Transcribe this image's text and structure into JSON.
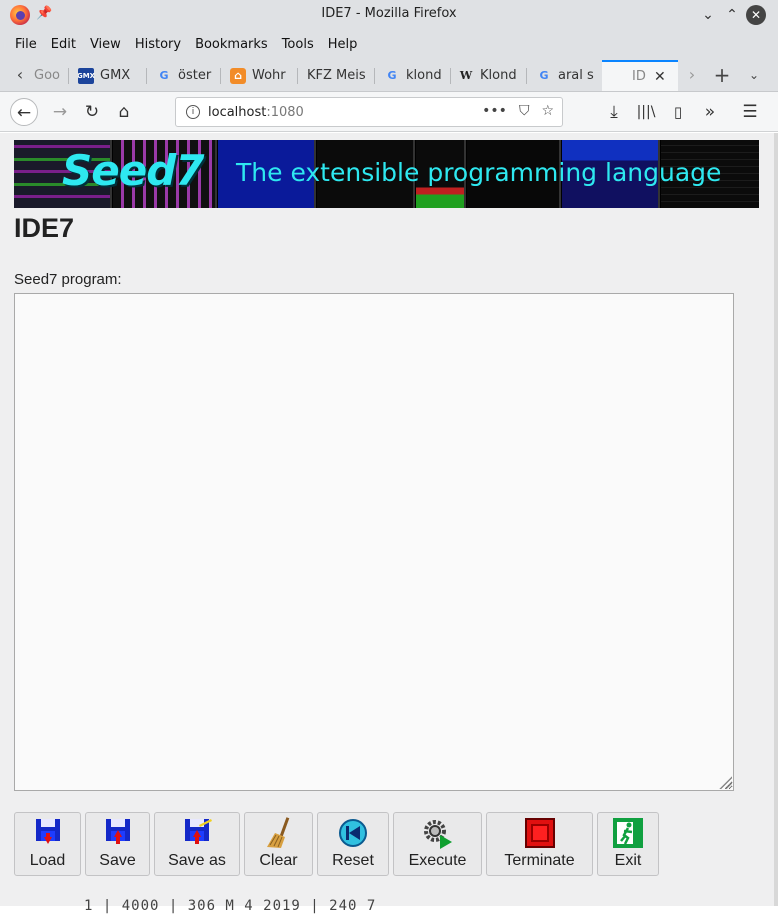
{
  "window": {
    "title": "IDE7 - Mozilla Firefox"
  },
  "menu": {
    "items": [
      "File",
      "Edit",
      "View",
      "History",
      "Bookmarks",
      "Tools",
      "Help"
    ]
  },
  "tabs": [
    {
      "label": "Goo",
      "icon": "google-icon"
    },
    {
      "label": "GMX",
      "icon": "gmx-icon"
    },
    {
      "label": "öster",
      "icon": "google-icon"
    },
    {
      "label": "Wohr",
      "icon": "home-icon"
    },
    {
      "label": "KFZ Meis",
      "icon": "none"
    },
    {
      "label": "klond",
      "icon": "google-icon"
    },
    {
      "label": "Klond",
      "icon": "wikipedia-icon"
    },
    {
      "label": "aral s",
      "icon": "google-icon"
    },
    {
      "label": "ID",
      "icon": "none",
      "active": true
    }
  ],
  "nav": {
    "url_host": "localhost",
    "url_port": ":1080"
  },
  "banner": {
    "logo_text": "Seed7",
    "tagline": "The extensible programming language"
  },
  "page": {
    "heading": "IDE7",
    "program_label": "Seed7 program:",
    "program_text": ""
  },
  "toolbar": {
    "load": "Load",
    "save": "Save",
    "save_as": "Save as",
    "clear": "Clear",
    "reset": "Reset",
    "execute": "Execute",
    "terminate": "Terminate",
    "exit": "Exit"
  },
  "footer": {
    "partial_text": "1 | 4000 | 306 M 4 2019 | 240 7"
  },
  "colors": {
    "accent": "#0a84ff",
    "banner_text": "#2ee8f0",
    "page_bg": "#efeff0"
  }
}
